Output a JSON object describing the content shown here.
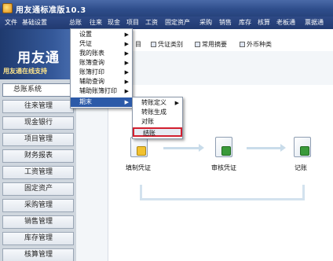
{
  "window": {
    "title": "用友通标准版10.3"
  },
  "menubar": {
    "items": [
      "文件",
      "基础设置",
      "总账",
      "往来",
      "现金",
      "项目",
      "工资",
      "固定资产",
      "采购",
      "销售",
      "库存",
      "核算",
      "老板通",
      "票据通"
    ]
  },
  "toolbar": {
    "items": [
      "目",
      "凭证类别",
      "常用摘要",
      "外币种类"
    ]
  },
  "logo": {
    "brand": "用友通",
    "slogan": "用友通在线支持"
  },
  "sidebar": {
    "items": [
      "总账系统",
      "往来管理",
      "现金银行",
      "项目管理",
      "财务报表",
      "工资管理",
      "固定资产",
      "采购管理",
      "销售管理",
      "库存管理",
      "核算管理"
    ],
    "active": 0
  },
  "menu_zongzhang": {
    "items": [
      {
        "label": "设置",
        "submenu": true
      },
      {
        "label": "凭证",
        "submenu": true
      },
      {
        "label": "我的账表",
        "submenu": true
      },
      {
        "label": "账簿查询",
        "submenu": true
      },
      {
        "label": "账簿打印",
        "submenu": true
      },
      {
        "label": "辅助查询",
        "submenu": true
      },
      {
        "label": "辅助账簿打印",
        "submenu": true
      },
      {
        "label": "期末",
        "submenu": true,
        "highlighted": true
      }
    ]
  },
  "menu_qimo": {
    "items": [
      {
        "label": "转账定义",
        "submenu": true
      },
      {
        "label": "转账生成",
        "submenu": false
      },
      {
        "label": "对账",
        "submenu": false
      },
      {
        "label": "结账",
        "submenu": false,
        "selected": true
      }
    ]
  },
  "flow": {
    "nodes": [
      "填制凭证",
      "审核凭证",
      "记账"
    ]
  },
  "colors": {
    "titlebar": "#2f4e8c",
    "menu_highlight": "#2c5aa8",
    "selection_box": "#d21f2f"
  }
}
